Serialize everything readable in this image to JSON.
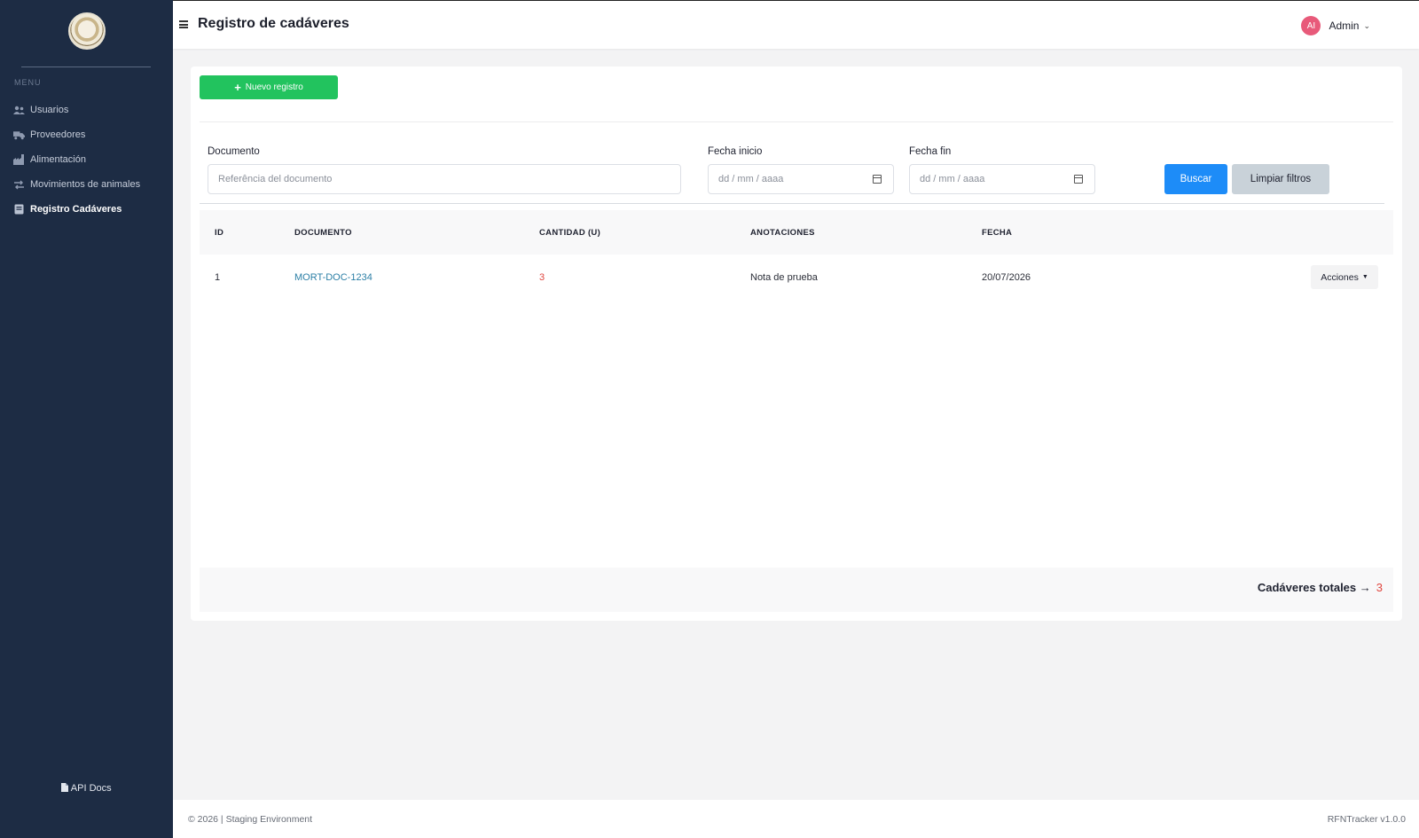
{
  "sidebar": {
    "menu_title": "MENU",
    "items": [
      {
        "label": "Usuarios",
        "icon": "users-icon"
      },
      {
        "label": "Proveedores",
        "icon": "truck-icon"
      },
      {
        "label": "Alimentación",
        "icon": "factory-icon"
      },
      {
        "label": "Movimientos de animales",
        "icon": "exchange-icon"
      },
      {
        "label": "Registro Cadáveres",
        "icon": "book-icon",
        "active": true
      }
    ],
    "api_docs": "API Docs"
  },
  "header": {
    "title": "Registro de cadáveres",
    "user_initials": "AI",
    "user_name": "Admin"
  },
  "toolbar": {
    "new_label": "Nuevo registro"
  },
  "filters": {
    "documento_label": "Documento",
    "documento_placeholder": "Referência del documento",
    "fecha_inicio_label": "Fecha inicio",
    "fecha_inicio_placeholder": "dd / mm / aaaa",
    "fecha_fin_label": "Fecha fin",
    "fecha_fin_placeholder": "dd / mm / aaaa",
    "buscar_label": "Buscar",
    "limpiar_label": "Limpiar filtros"
  },
  "table": {
    "columns": [
      "ID",
      "DOCUMENTO",
      "CANTIDAD (U)",
      "ANOTACIONES",
      "FECHA"
    ],
    "rows": [
      {
        "id": "1",
        "documento": "MORT-DOC-1234",
        "cantidad": "3",
        "anotaciones": "Nota de prueba",
        "fecha": "20/07/2026",
        "acciones": "Acciones"
      }
    ],
    "total_label": "Cadáveres totales →",
    "total_value": "3"
  },
  "footer": {
    "left": "© 2026 | Staging Environment",
    "right": "RFNTracker v1.0.0"
  },
  "colors": {
    "sidebar_bg": "#1d2c44",
    "primary": "#1d8cf8",
    "success": "#22c35e",
    "danger": "#e0463f",
    "link": "#2c7fa6"
  }
}
